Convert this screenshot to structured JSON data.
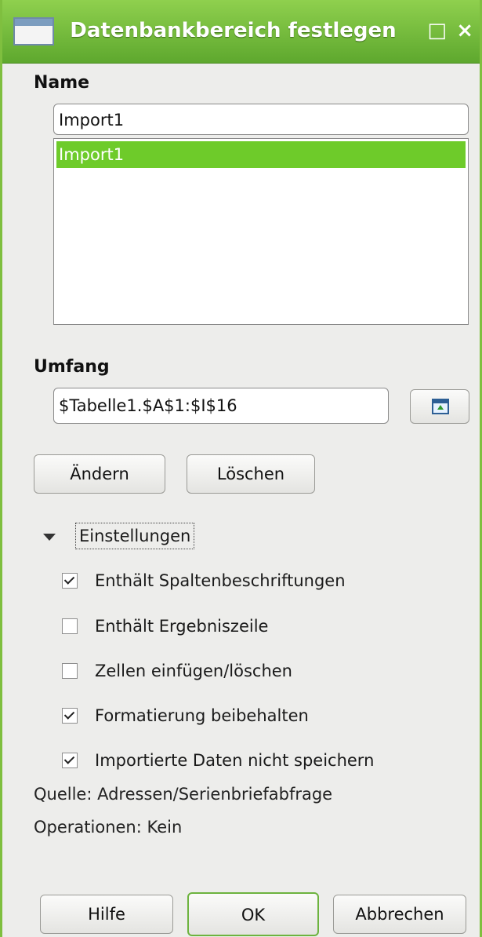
{
  "window": {
    "title": "Datenbankbereich festlegen",
    "maximize_glyph": "□",
    "close_glyph": "×"
  },
  "name_section": {
    "label": "Name",
    "input_value": "Import1",
    "list_items": [
      "Import1"
    ],
    "selected_index": 0
  },
  "range_section": {
    "label": "Umfang",
    "input_value": "$Tabelle1.$A$1:$I$16",
    "shrink_icon": "shrink-dialog-icon"
  },
  "actions": {
    "change_label": "Ändern",
    "delete_label": "Löschen"
  },
  "options": {
    "toggle_label": "Einstellungen",
    "expanded": true,
    "checkboxes": [
      {
        "label": "Enthält Spaltenbeschriftungen",
        "checked": true
      },
      {
        "label": "Enthält Ergebniszeile",
        "checked": false
      },
      {
        "label": "Zellen einfügen/löschen",
        "checked": false
      },
      {
        "label": "Formatierung beibehalten",
        "checked": true
      },
      {
        "label": "Importierte Daten nicht speichern",
        "checked": true
      }
    ],
    "source_text": "Quelle: Adressen/Serienbriefabfrage",
    "operations_text": "Operationen: Kein"
  },
  "footer": {
    "help_label": "Hilfe",
    "ok_label": "OK",
    "cancel_label": "Abbrechen"
  },
  "colors": {
    "titlebar": "#6cb536",
    "selection": "#6ecb2a",
    "background": "#ededeb"
  }
}
